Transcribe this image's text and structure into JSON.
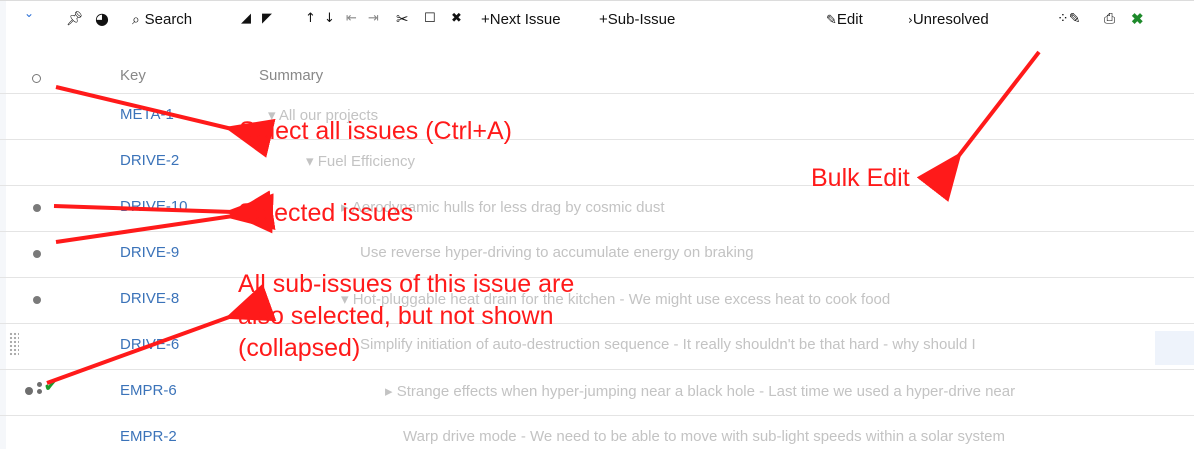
{
  "toolbar": {
    "search_label": "Search",
    "next_issue_label": "+Next Issue",
    "sub_issue_label": "+Sub-Issue",
    "edit_label": "Edit",
    "unresolved_label": "Unresolved",
    "icons": [
      "collapse-chevron",
      "pin",
      "clock",
      "search",
      "move-left",
      "move-right",
      "move-up",
      "move-down",
      "indent-left",
      "indent-right",
      "scissors",
      "clipboard",
      "delete",
      "bulk-edit",
      "print",
      "excel"
    ]
  },
  "table": {
    "headers": {
      "key": "Key",
      "summary": "Summary"
    },
    "rows": [
      {
        "key": "META-1",
        "summary": "All our projects",
        "selected": false
      },
      {
        "key": "DRIVE-2",
        "summary": "Fuel Efficiency",
        "selected": false
      },
      {
        "key": "DRIVE-10",
        "summary": "Aerodynamic hulls for less drag by cosmic dust",
        "selected": true
      },
      {
        "key": "DRIVE-9",
        "summary": "Use reverse hyper-driving to accumulate energy on braking",
        "selected": true
      },
      {
        "key": "DRIVE-8",
        "summary": "Hot-pluggable heat drain for the kitchen  -  We might use excess heat to cook food",
        "selected": true
      },
      {
        "key": "DRIVE-6",
        "summary": "Simplify initiation of auto-destruction sequence  -  It really shouldn't be that hard - why should I",
        "selected": false
      },
      {
        "key": "EMPR-6",
        "summary": "Strange effects when hyper-jumping near a black hole  -  Last time we used a hyper-drive near",
        "selected": true
      },
      {
        "key": "EMPR-2",
        "summary": "Warp drive mode  -  We need to be able to move with sub-light speeds within a solar system",
        "selected": false
      }
    ]
  },
  "annotations": {
    "select_all": "Select all issues (Ctrl+A)",
    "bulk_edit": "Bulk Edit",
    "selected_issues": "Selected issues",
    "sub_issues_line1": "All sub-issues of this issue are",
    "sub_issues_line2": "also selected, but not shown",
    "sub_issues_line3": "(collapsed)"
  },
  "colors": {
    "annotation": "#ff1a1a",
    "key_link": "#3b73b9",
    "summary_text": "#c3c3c3",
    "check": "#1c9a2a"
  }
}
